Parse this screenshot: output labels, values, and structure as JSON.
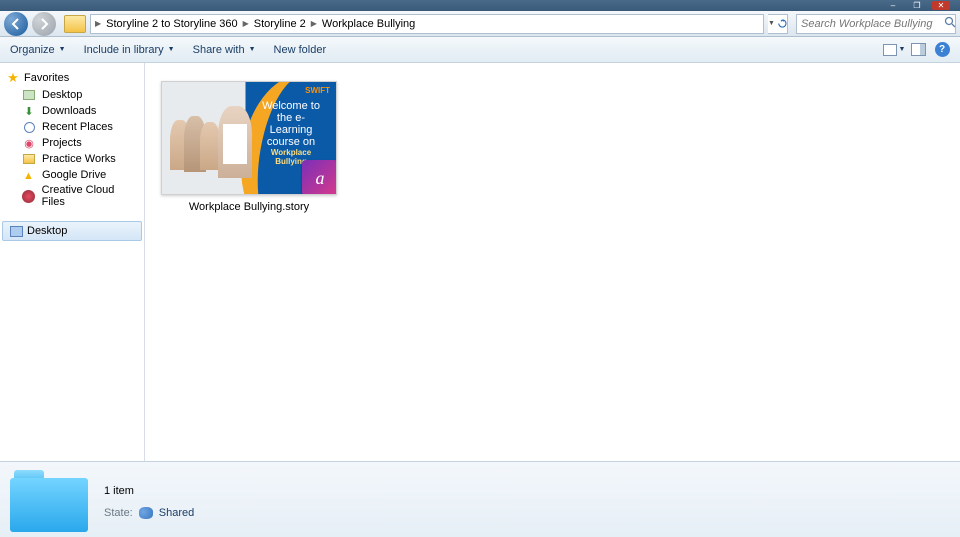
{
  "titlebar": {
    "minimize": "–",
    "maximize": "❐",
    "close": "✕"
  },
  "nav": {
    "crumbs": [
      "Storyline 2 to Storyline 360",
      "Storyline 2",
      "Workplace Bullying"
    ],
    "search_placeholder": "Search Workplace Bullying"
  },
  "toolbar": {
    "organize": "Organize",
    "include": "Include in library",
    "share": "Share with",
    "newfolder": "New folder"
  },
  "sidebar": {
    "favorites_label": "Favorites",
    "items": [
      {
        "label": "Desktop"
      },
      {
        "label": "Downloads"
      },
      {
        "label": "Recent Places"
      },
      {
        "label": "Projects"
      },
      {
        "label": "Practice Works"
      },
      {
        "label": "Google Drive"
      },
      {
        "label": "Creative Cloud Files"
      }
    ],
    "desktop_label": "Desktop"
  },
  "content": {
    "file": {
      "name": "Workplace Bullying.story",
      "thumb_brand": "SWIFT",
      "thumb_line1": "Welcome to the e-Learning course on",
      "thumb_line2": "Workplace Bullying",
      "badge_letter": "a"
    }
  },
  "details": {
    "count": "1 item",
    "state_label": "State:",
    "state_value": "Shared"
  }
}
